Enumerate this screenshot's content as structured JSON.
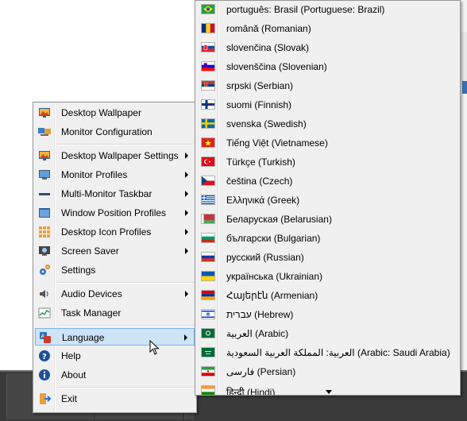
{
  "main_menu": {
    "items": [
      {
        "label": "Desktop Wallpaper",
        "icon": "wallpaper-icon",
        "submenu": false
      },
      {
        "label": "Monitor Configuration",
        "icon": "monitor-config-icon",
        "submenu": false
      },
      {
        "label": "Desktop Wallpaper Settings",
        "icon": "wallpaper-settings-icon",
        "submenu": true
      },
      {
        "label": "Monitor Profiles",
        "icon": "monitor-icon",
        "submenu": true
      },
      {
        "label": "Multi-Monitor Taskbar",
        "icon": "taskbar-icon",
        "submenu": true
      },
      {
        "label": "Window Position Profiles",
        "icon": "window-icon",
        "submenu": true
      },
      {
        "label": "Desktop Icon Profiles",
        "icon": "grid-icon",
        "submenu": true
      },
      {
        "label": "Screen Saver",
        "icon": "screensaver-icon",
        "submenu": true
      },
      {
        "label": "Settings",
        "icon": "gears-icon",
        "submenu": false
      },
      {
        "label": "Audio Devices",
        "icon": "speaker-icon",
        "submenu": true
      },
      {
        "label": "Task Manager",
        "icon": "chart-icon",
        "submenu": false
      },
      {
        "label": "Language",
        "icon": "language-icon",
        "submenu": true,
        "active": true
      },
      {
        "label": "Help",
        "icon": "help-icon",
        "submenu": false
      },
      {
        "label": "About",
        "icon": "info-icon",
        "submenu": false
      },
      {
        "label": "Exit",
        "icon": "exit-icon",
        "submenu": false
      }
    ]
  },
  "language_menu": {
    "items": [
      {
        "label": "português: Brasil (Portuguese: Brazil)",
        "flag": "brazil"
      },
      {
        "label": "română (Romanian)",
        "flag": "romania"
      },
      {
        "label": "slovenčina (Slovak)",
        "flag": "slovakia"
      },
      {
        "label": "slovenščina (Slovenian)",
        "flag": "slovenia"
      },
      {
        "label": "srpski (Serbian)",
        "flag": "serbia"
      },
      {
        "label": "suomi (Finnish)",
        "flag": "finland"
      },
      {
        "label": "svenska (Swedish)",
        "flag": "sweden"
      },
      {
        "label": "Tiếng Việt (Vietnamese)",
        "flag": "vietnam"
      },
      {
        "label": "Türkçe (Turkish)",
        "flag": "turkey"
      },
      {
        "label": "čeština (Czech)",
        "flag": "czech"
      },
      {
        "label": "Ελληνικά (Greek)",
        "flag": "greece"
      },
      {
        "label": "Беларуская (Belarusian)",
        "flag": "belarus"
      },
      {
        "label": "български (Bulgarian)",
        "flag": "bulgaria"
      },
      {
        "label": "русский (Russian)",
        "flag": "russia"
      },
      {
        "label": "українська (Ukrainian)",
        "flag": "ukraine"
      },
      {
        "label": "Հայերէն (Armenian)",
        "flag": "armenia"
      },
      {
        "label": "עברית (Hebrew)",
        "flag": "israel"
      },
      {
        "label": "العربية (Arabic)",
        "flag": "saudi"
      },
      {
        "label": "العربية: المملكة العربية السعودية (Arabic: Saudi Arabia)",
        "flag": "saudi"
      },
      {
        "label": "فارسی (Persian)",
        "flag": "iran"
      },
      {
        "label": "हिन्दी (Hindi)",
        "flag": "india"
      }
    ],
    "scroll_down_icon": "scroll-down-arrow-icon"
  }
}
